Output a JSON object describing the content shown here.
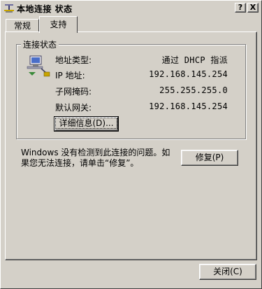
{
  "window": {
    "title": "本地连接 状态",
    "help_button": "?",
    "close_button": "X"
  },
  "tabs": [
    {
      "label": "常规",
      "selected": false
    },
    {
      "label": "支持",
      "selected": true
    }
  ],
  "connection_status": {
    "group_label": "连接状态",
    "rows": [
      {
        "label": "地址类型:",
        "value": "通过 DHCP 指派"
      },
      {
        "label": "IP 地址:",
        "value": "192.168.145.254"
      },
      {
        "label": "子网掩码:",
        "value": "255.255.255.0"
      },
      {
        "label": "默认网关:",
        "value": "192.168.145.254"
      }
    ],
    "details_button": "详细信息(D)..."
  },
  "diagnosis": {
    "message": "Windows 没有检测到此连接的问题。如果您无法连接，请单击“修复”。",
    "repair_button": "修复(P)"
  },
  "footer": {
    "close_button": "关闭(C)"
  }
}
